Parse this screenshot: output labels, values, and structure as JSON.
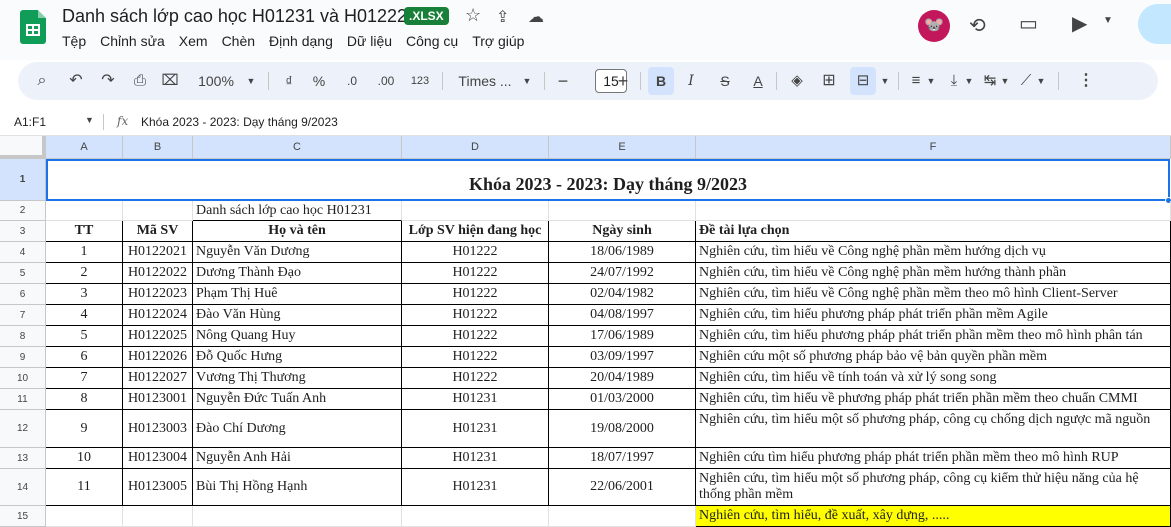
{
  "doc": {
    "title": "Danh sách lớp cao học H01231 và H01222",
    "badge": ".XLSX",
    "avatar_glyph": "🐭"
  },
  "menu": [
    "Tệp",
    "Chỉnh sửa",
    "Xem",
    "Chèn",
    "Định dạng",
    "Dữ liệu",
    "Công cụ",
    "Trợ giúp"
  ],
  "toolbar": {
    "zoom": "100%",
    "currency": "₫",
    "percent": "%",
    "dec_decrease": ".0",
    "dec_increase": ".00",
    "format_123": "123",
    "font": "Times ...",
    "font_size": "15",
    "bold": "B",
    "italic": "I",
    "strike": "S",
    "text_color": "A"
  },
  "formula_bar": {
    "name_box": "A1:F1",
    "fx": "fx",
    "content": "Khóa 2023 - 2023: Dạy tháng 9/2023"
  },
  "columns": [
    "A",
    "B",
    "C",
    "D",
    "E",
    "F"
  ],
  "rows": [
    "1",
    "2",
    "3",
    "4",
    "5",
    "6",
    "7",
    "8",
    "9",
    "10",
    "11",
    "12",
    "13",
    "14",
    "15"
  ],
  "sheet": {
    "title": "Khóa 2023 - 2023: Dạy tháng 9/2023",
    "subtitle": "Danh sách lớp cao học H01231",
    "headers": [
      "TT",
      "Mã SV",
      "Họ và tên",
      "Lớp SV hiện đang học",
      "Ngày sinh",
      "Đề tài lựa chọn"
    ],
    "data": [
      [
        "1",
        "H0122021",
        "Nguyễn Văn Dương",
        "H01222",
        "18/06/1989",
        "Nghiên cứu, tìm hiểu về Công nghệ phần mềm hướng dịch vụ"
      ],
      [
        "2",
        "H0122022",
        "Dương Thành Đạo",
        "H01222",
        "24/07/1992",
        "Nghiên cứu, tìm hiểu về Công nghệ phần mềm hướng thành phần"
      ],
      [
        "3",
        "H0122023",
        "Phạm Thị Huê",
        "H01222",
        "02/04/1982",
        "Nghiên cứu, tìm hiểu về Công nghệ phần mềm theo mô hình Client-Server"
      ],
      [
        "4",
        "H0122024",
        "Đào Văn Hùng",
        "H01222",
        "04/08/1997",
        "Nghiên cứu, tìm hiểu phương pháp phát triển phần mềm Agile"
      ],
      [
        "5",
        "H0122025",
        "Nông Quang Huy",
        "H01222",
        "17/06/1989",
        "Nghiên cứu, tìm hiểu phương pháp phát triển phần mềm theo mô hình phân tán"
      ],
      [
        "6",
        "H0122026",
        "Đỗ Quốc Hưng",
        "H01222",
        "03/09/1997",
        "Nghiên cứu một số phương pháp bảo vệ bản quyền phần mềm"
      ],
      [
        "7",
        "H0122027",
        "Vương Thị Thương",
        "H01222",
        "20/04/1989",
        "Nghiên cứu, tìm hiểu về tính toán và xử lý song song"
      ],
      [
        "8",
        "H0123001",
        "Nguyễn Đức Tuấn Anh",
        "H01231",
        "01/03/2000",
        "Nghiên cứu, tìm hiểu về phương pháp phát triển phần mềm theo chuẩn CMMI"
      ],
      [
        "9",
        "H0123003",
        "Đào Chí Dương",
        "H01231",
        "19/08/2000",
        "Nghiên cứu, tìm hiểu một số phương pháp, công cụ chống dịch ngược mã nguồn"
      ],
      [
        "10",
        "H0123004",
        "Nguyễn Anh Hải",
        "H01231",
        "18/07/1997",
        "Nghiên cứu tìm hiểu phương pháp phát triển phần mềm theo mô hình RUP"
      ],
      [
        "11",
        "H0123005",
        "Bùi Thị Hồng Hạnh",
        "H01231",
        "22/06/2001",
        "Nghiên cứu, tìm hiểu một số phương pháp, công cụ kiểm thử hiệu năng của hệ thống phần mềm"
      ]
    ],
    "footer_note": "Nghiên cứu, tìm hiểu, đề xuất, xây dựng, .....",
    "footer_note_color": "#ffff00"
  }
}
